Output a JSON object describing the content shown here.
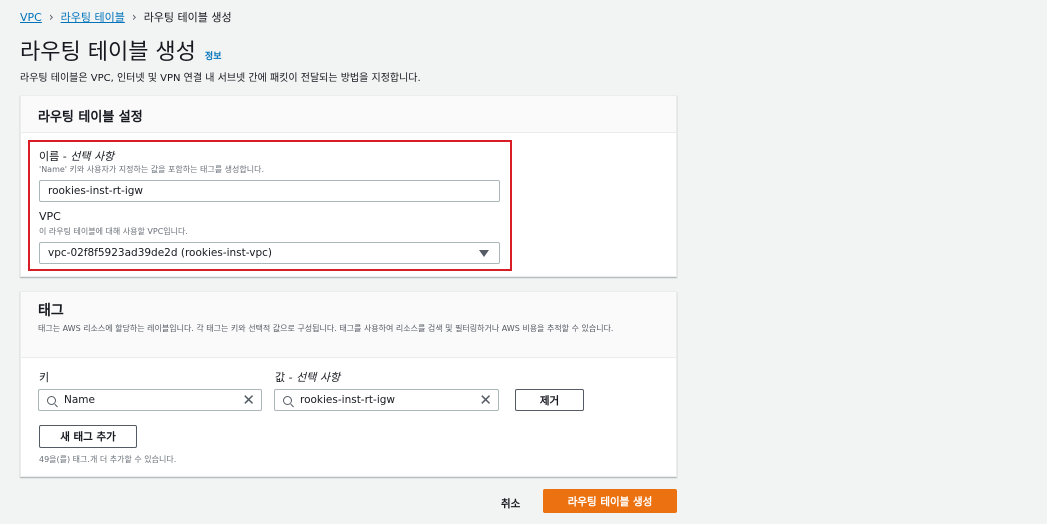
{
  "breadcrumb": {
    "vpc": "VPC",
    "route_tables": "라우팅 테이블",
    "current": "라우팅 테이블 생성"
  },
  "page": {
    "title": "라우팅 테이블 생성",
    "info_link": "정보",
    "description": "라우팅 테이블은 VPC, 인터넷 및 VPN 연결 내 서브넷 간에 패킷이 전달되는 방법을 지정합니다."
  },
  "settings": {
    "header": "라우팅 테이블 설정",
    "name_label": "이름 - ",
    "name_optional": "선택 사항",
    "name_hint": "'Name' 키와 사용자가 지정하는 값을 포함하는 태그를 생성합니다.",
    "name_value": "rookies-inst-rt-igw",
    "vpc_label": "VPC",
    "vpc_hint": "이 라우팅 테이블에 대해 사용할 VPC입니다.",
    "vpc_value": "vpc-02f8f5923ad39de2d (rookies-inst-vpc)"
  },
  "tags": {
    "header": "태그",
    "description": "태그는 AWS 리소스에 할당하는 레이블입니다. 각 태그는 키와 선택적 값으로 구성됩니다. 태그를 사용하여 리소스를 검색 및 필터링하거나 AWS 비용을 추적할 수 있습니다.",
    "key_label": "키",
    "value_label": "값 - ",
    "value_optional": "선택 사항",
    "key_value": "Name",
    "value_value": "rookies-inst-rt-igw",
    "remove_button": "제거",
    "add_button": "새 태그 추가",
    "remaining": "49을(를) 태그.개 더 추가할 수 있습니다."
  },
  "footer": {
    "cancel": "취소",
    "create": "라우팅 테이블 생성"
  },
  "colors": {
    "primary": "#ec7211",
    "link": "#0073bb",
    "highlight": "#d91d27"
  }
}
